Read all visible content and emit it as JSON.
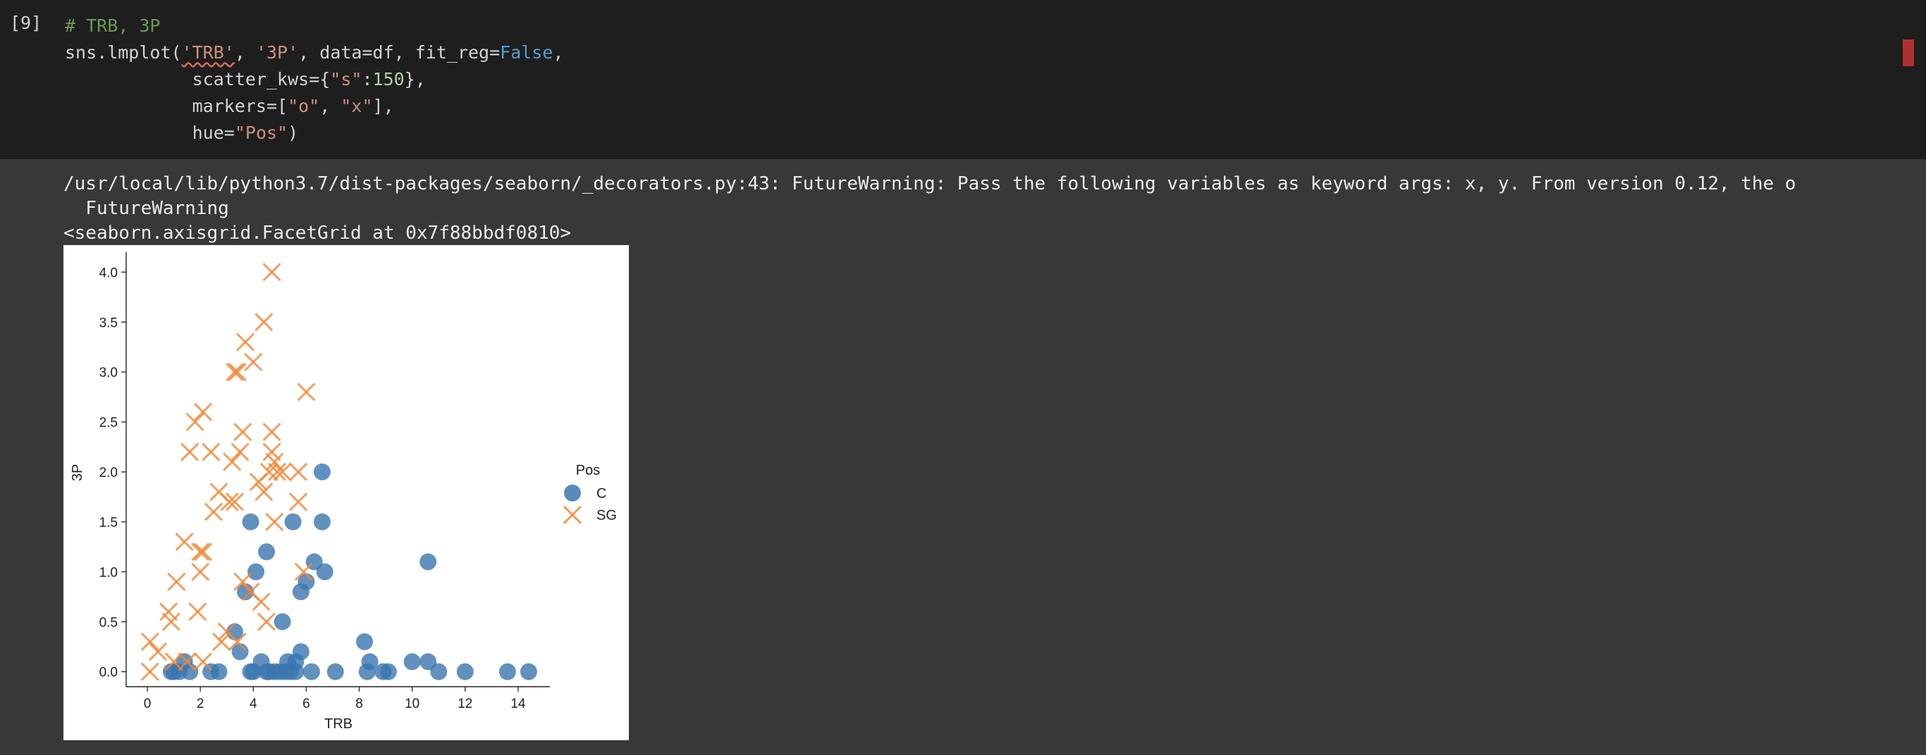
{
  "cell": {
    "execution_count": "[9]",
    "code": {
      "line1_comment": "# TRB, 3P",
      "line2": {
        "call": "sns.lmplot(",
        "arg_x": "'TRB'",
        "sep1": ", ",
        "arg_y": "'3P'",
        "mid": ", data=df, fit_reg=",
        "false_kw": "False",
        "end": ","
      },
      "line3": {
        "indent": "            ",
        "pre": "scatter_kws={",
        "key": "\"s\"",
        "colon": ":",
        "val": "150",
        "post": "},"
      },
      "line4": {
        "indent": "            ",
        "pre": "markers=[",
        "m1": "\"o\"",
        "sep": ", ",
        "m2": "\"x\"",
        "post": "],"
      },
      "line5": {
        "indent": "            ",
        "pre": "hue=",
        "val": "\"Pos\"",
        "post": ")"
      }
    }
  },
  "output": {
    "warning_line1": "/usr/local/lib/python3.7/dist-packages/seaborn/_decorators.py:43: FutureWarning: Pass the following variables as keyword args: x, y. From version 0.12, the o",
    "warning_line2": "  FutureWarning",
    "repr": "<seaborn.axisgrid.FacetGrid at 0x7f88bbdf0810>"
  },
  "chart_data": {
    "type": "scatter",
    "title": "",
    "xlabel": "TRB",
    "ylabel": "3P",
    "xlim": [
      -0.8,
      15.2
    ],
    "ylim": [
      -0.15,
      4.2
    ],
    "xticks": [
      0,
      2,
      4,
      6,
      8,
      10,
      12,
      14
    ],
    "yticks": [
      0.0,
      0.5,
      1.0,
      1.5,
      2.0,
      2.5,
      3.0,
      3.5,
      4.0
    ],
    "grid": false,
    "legend": {
      "title": "Pos",
      "placement": "right"
    },
    "series": [
      {
        "name": "C",
        "marker": "o",
        "color": "#3b75af",
        "points": [
          [
            0.9,
            0
          ],
          [
            1.0,
            0
          ],
          [
            1.2,
            0
          ],
          [
            1.4,
            0.1
          ],
          [
            1.6,
            0
          ],
          [
            2.4,
            0
          ],
          [
            2.7,
            0
          ],
          [
            3.3,
            0.4
          ],
          [
            3.5,
            0.2
          ],
          [
            3.7,
            0.8
          ],
          [
            3.9,
            1.5
          ],
          [
            3.9,
            0
          ],
          [
            4.0,
            0
          ],
          [
            4.1,
            1.0
          ],
          [
            4.3,
            0.1
          ],
          [
            4.5,
            1.2
          ],
          [
            4.5,
            0
          ],
          [
            4.6,
            0
          ],
          [
            4.8,
            0
          ],
          [
            5.0,
            0
          ],
          [
            5.1,
            0.5
          ],
          [
            5.2,
            0
          ],
          [
            5.3,
            0.1
          ],
          [
            5.4,
            0
          ],
          [
            5.5,
            1.5
          ],
          [
            5.6,
            0.1
          ],
          [
            5.6,
            0
          ],
          [
            5.8,
            0.2
          ],
          [
            5.8,
            0.8
          ],
          [
            6.0,
            0.9
          ],
          [
            6.2,
            0
          ],
          [
            6.3,
            1.1
          ],
          [
            6.6,
            2.0
          ],
          [
            6.6,
            1.5
          ],
          [
            6.7,
            1.0
          ],
          [
            7.1,
            0
          ],
          [
            8.2,
            0.3
          ],
          [
            8.3,
            0
          ],
          [
            8.4,
            0.1
          ],
          [
            8.9,
            0
          ],
          [
            9.1,
            0
          ],
          [
            10.0,
            0.1
          ],
          [
            10.6,
            0.1
          ],
          [
            10.6,
            1.1
          ],
          [
            11.0,
            0
          ],
          [
            12.0,
            0
          ],
          [
            13.6,
            0
          ],
          [
            14.4,
            0
          ]
        ]
      },
      {
        "name": "SG",
        "marker": "x",
        "color": "#ef8636",
        "points": [
          [
            0.1,
            0.3
          ],
          [
            0.1,
            0
          ],
          [
            0.4,
            0.2
          ],
          [
            0.8,
            0.6
          ],
          [
            0.9,
            0.5
          ],
          [
            1.0,
            0.1
          ],
          [
            1.1,
            0.9
          ],
          [
            1.4,
            1.3
          ],
          [
            1.5,
            0.1
          ],
          [
            1.6,
            2.2
          ],
          [
            1.8,
            2.5
          ],
          [
            1.9,
            0.6
          ],
          [
            2.0,
            1.2
          ],
          [
            2.0,
            1.0
          ],
          [
            2.1,
            1.2
          ],
          [
            2.1,
            0.1
          ],
          [
            2.1,
            2.6
          ],
          [
            2.4,
            2.2
          ],
          [
            2.5,
            1.6
          ],
          [
            2.7,
            1.8
          ],
          [
            2.8,
            0.3
          ],
          [
            3.0,
            0.4
          ],
          [
            3.1,
            1.7
          ],
          [
            3.2,
            2.1
          ],
          [
            3.3,
            1.7
          ],
          [
            3.3,
            3.0
          ],
          [
            3.4,
            0.3
          ],
          [
            3.4,
            3.0
          ],
          [
            3.5,
            2.2
          ],
          [
            3.6,
            2.4
          ],
          [
            3.6,
            0.9
          ],
          [
            3.7,
            3.3
          ],
          [
            3.9,
            0.8
          ],
          [
            4.0,
            3.1
          ],
          [
            4.2,
            1.9
          ],
          [
            4.3,
            0.7
          ],
          [
            4.4,
            1.8
          ],
          [
            4.4,
            3.5
          ],
          [
            4.5,
            0.5
          ],
          [
            4.6,
            2.0
          ],
          [
            4.7,
            4.0
          ],
          [
            4.7,
            2.4
          ],
          [
            4.7,
            2.2
          ],
          [
            4.8,
            2.1
          ],
          [
            4.8,
            1.5
          ],
          [
            4.9,
            2.0
          ],
          [
            5.1,
            2.0
          ],
          [
            5.7,
            2.0
          ],
          [
            5.7,
            1.7
          ],
          [
            5.9,
            1.0
          ],
          [
            6.0,
            2.8
          ]
        ]
      }
    ]
  }
}
